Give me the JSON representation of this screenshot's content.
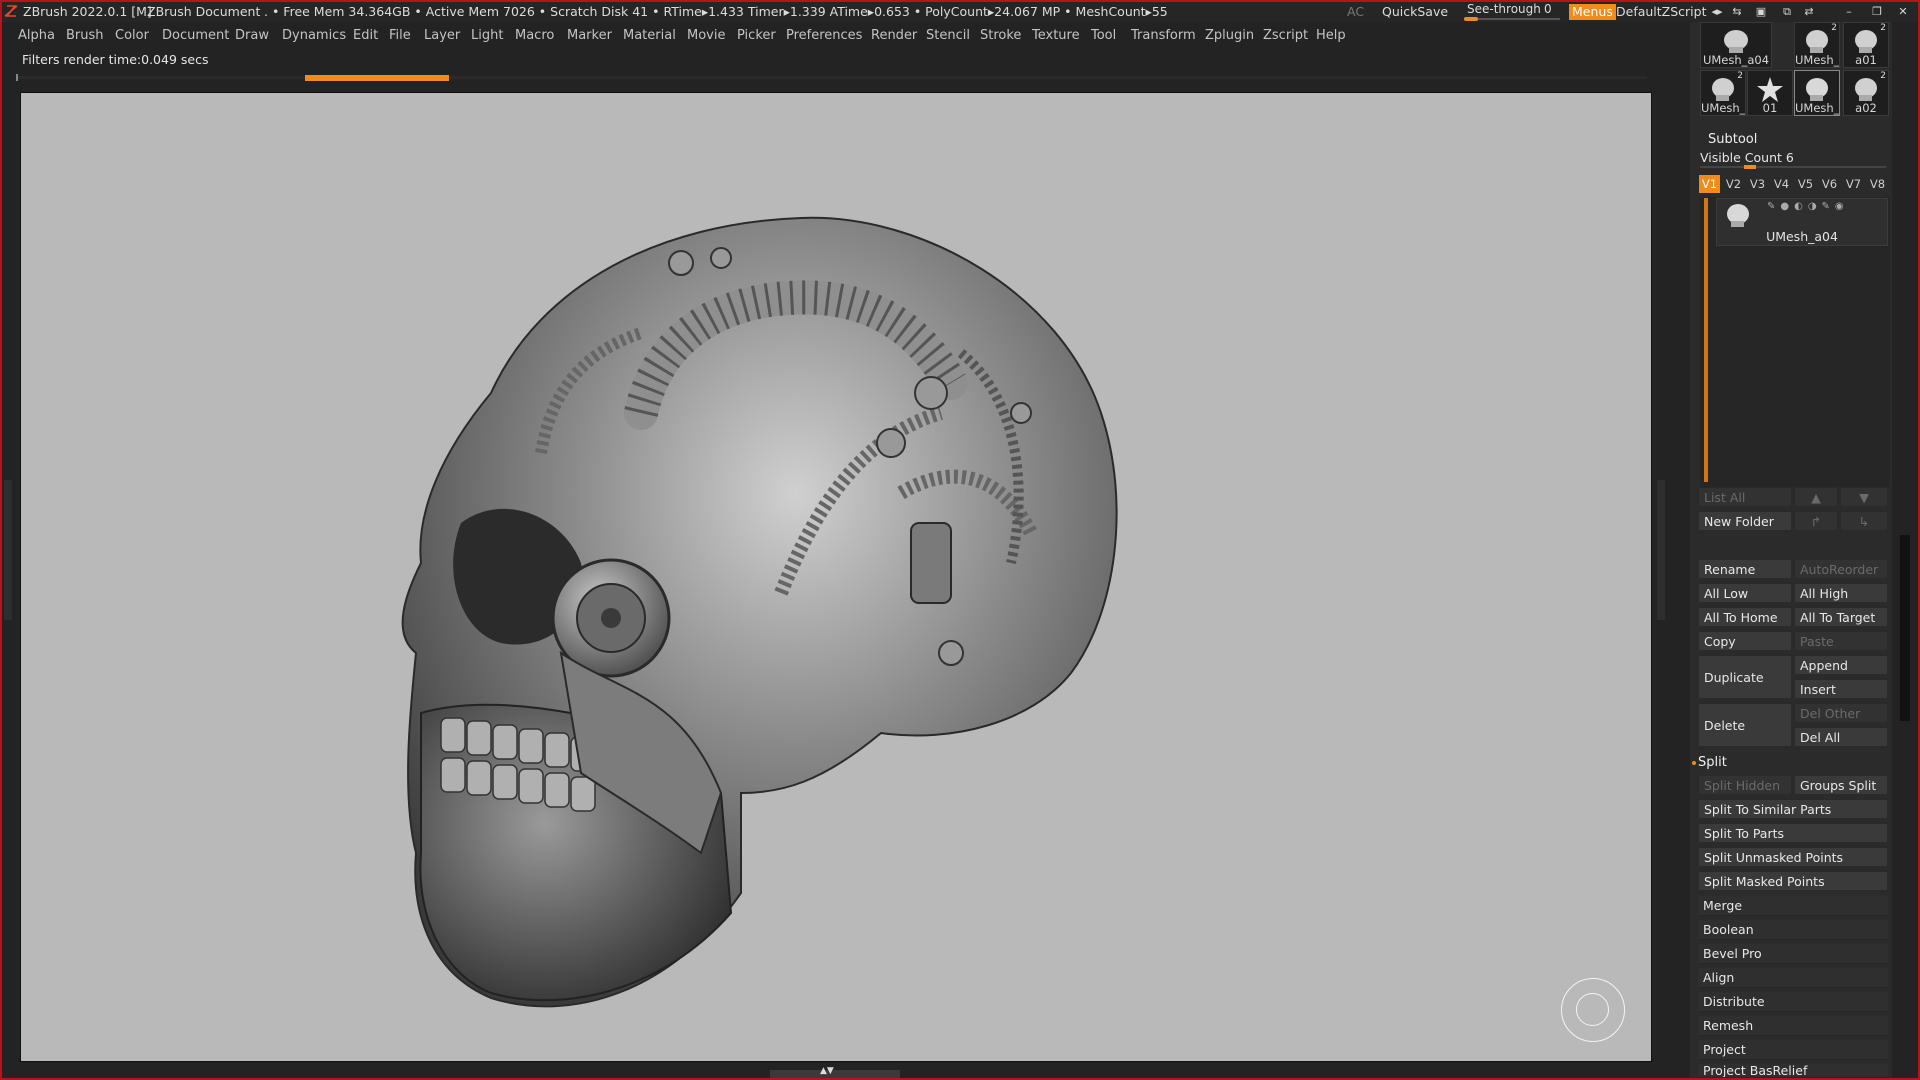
{
  "window": {
    "app_title": "ZBrush 2022.0.1 [M]",
    "document": "ZBrush Document",
    "stats": ". • Free Mem 34.364GB • Active Mem 7026 • Scratch Disk 41 •  RTime▸1.433 Timer▸1.339 ATime▸0.653 • PolyCount▸24.067 MP  • MeshCount▸55",
    "ac": "AC",
    "quicksave": "QuickSave",
    "see_through_label": "See-through",
    "see_through_value": "0",
    "menus": "Menus",
    "script": "DefaultZScript"
  },
  "menubar": {
    "items": [
      "Alpha",
      "Brush",
      "Color",
      "Document",
      "Draw",
      "Dynamics",
      "Edit",
      "File",
      "Layer",
      "Light",
      "Macro",
      "Marker",
      "Material",
      "Movie",
      "Picker",
      "Preferences",
      "Render",
      "Stencil",
      "Stroke",
      "Texture",
      "Tool",
      "Transform",
      "Zplugin",
      "Zscript",
      "Help"
    ]
  },
  "status": {
    "text": "Filters render time:0.049 secs"
  },
  "tool_thumbs": [
    {
      "label": "UMesh_a04",
      "num": ""
    },
    {
      "label": "UMesh_",
      "num": "2"
    },
    {
      "label": "a01",
      "num": "2"
    },
    {
      "label": "UMesh_",
      "num": "2"
    },
    {
      "label": "01",
      "num": ""
    },
    {
      "label": "UMesh_",
      "num": ""
    },
    {
      "label": "a02",
      "num": "2"
    }
  ],
  "subtool": {
    "header": "Subtool",
    "visible_count_label": "Visible Count 6",
    "visible_count_fraction": 0.25,
    "versions": [
      "V1",
      "V2",
      "V3",
      "V4",
      "V5",
      "V6",
      "V7",
      "V8"
    ],
    "active_version": "V1",
    "item_name": "UMesh_a04",
    "list_all": "List All",
    "new_folder": "New Folder"
  },
  "buttons": {
    "rename": "Rename",
    "autoreorder": "AutoReorder",
    "all_low": "All Low",
    "all_high": "All High",
    "all_to_home": "All To Home",
    "all_to_target": "All To Target",
    "copy": "Copy",
    "paste": "Paste",
    "duplicate": "Duplicate",
    "append": "Append",
    "insert": "Insert",
    "delete": "Delete",
    "del_other": "Del Other",
    "del_all": "Del All"
  },
  "split": {
    "header": "Split",
    "split_hidden": "Split Hidden",
    "groups_split": "Groups Split",
    "items": [
      "Split To Similar Parts",
      "Split To Parts",
      "Split Unmasked Points",
      "Split Masked Points"
    ]
  },
  "sections": [
    "Merge",
    "Boolean",
    "Bevel Pro",
    "Align",
    "Distribute",
    "Remesh",
    "Project",
    "Project BasRelief"
  ],
  "colors": {
    "accent": "#f08b1c",
    "frame": "#b8121a",
    "viewport_bg": "#b9b9b9"
  }
}
